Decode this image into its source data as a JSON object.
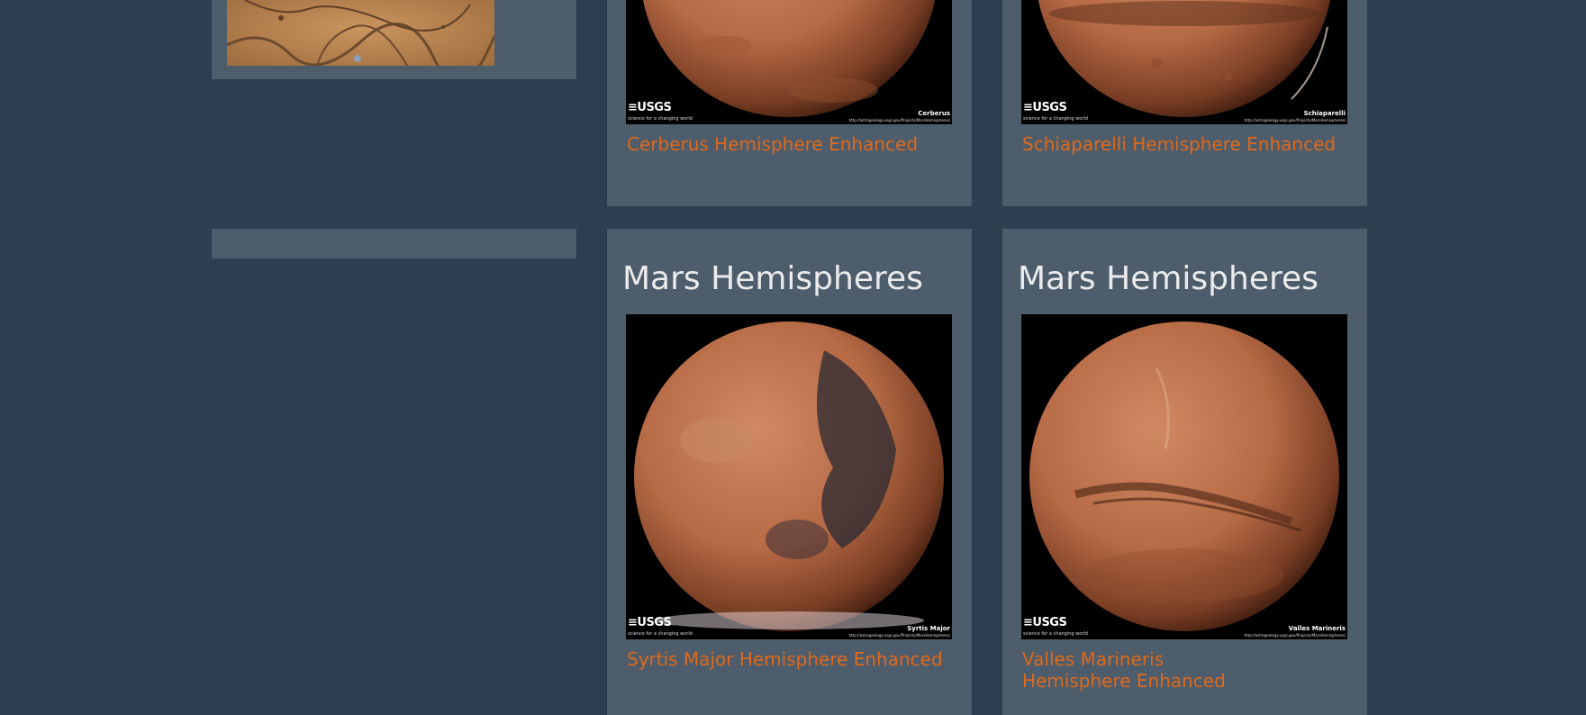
{
  "row1": {
    "cards": [
      {
        "link": "Cerberus Hemisphere Enhanced",
        "caption": "Cerberus",
        "url": "http://astrogeology.usgs.gov/Projects/MarsHemispheres/"
      },
      {
        "link": "Schiaparelli Hemisphere Enhanced",
        "caption": "Schiaparelli",
        "url": "http://astrogeology.usgs.gov/Projects/MarsHemispheres/"
      }
    ]
  },
  "row2": {
    "cards": [
      {
        "title": "Mars Hemispheres",
        "link": "Syrtis Major Hemisphere Enhanced",
        "caption": "Syrtis Major",
        "url": "http://astrogeology.usgs.gov/Projects/MarsHemispheres/"
      },
      {
        "title": "Mars Hemispheres",
        "link": "Valles Marineris Hemisphere Enhanced",
        "caption": "Valles Marineris",
        "url": "http://astrogeology.usgs.gov/Projects/MarsHemispheres/"
      }
    ]
  },
  "usgs": {
    "logo": "≡USGS",
    "tagline": "science for a changing world"
  },
  "icons": {
    "logo": "usgs-logo-icon"
  },
  "colors": {
    "background": "#2c3e50",
    "card": "#4e5d6c",
    "link": "#df691a",
    "heading": "#ebebeb"
  }
}
